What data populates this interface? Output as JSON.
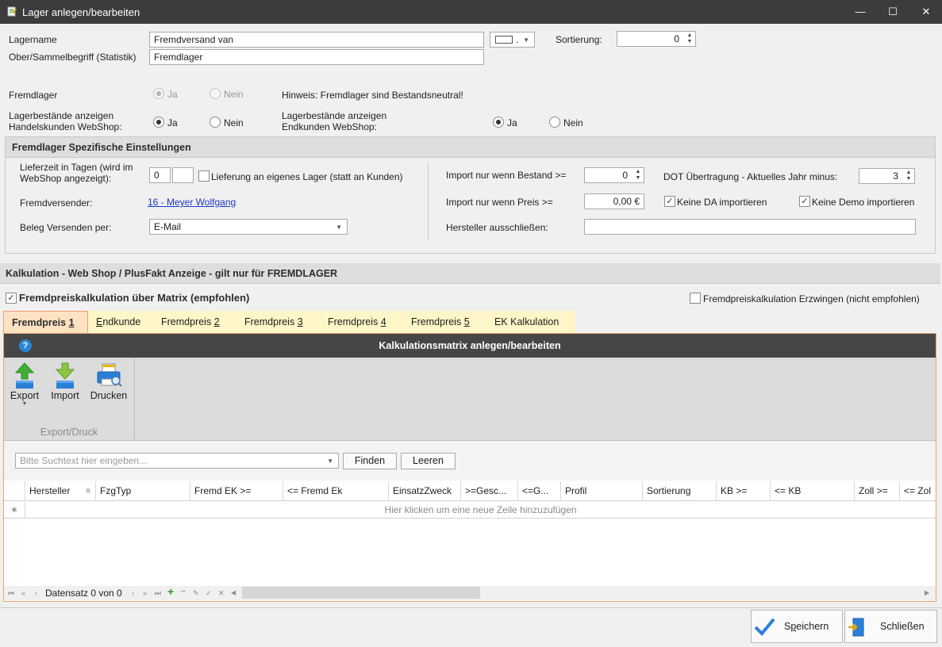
{
  "window": {
    "title": "Lager anlegen/bearbeiten",
    "minimize": "—",
    "maximize": "☐",
    "close": "✕"
  },
  "form": {
    "lagername_label": "Lagername",
    "lagername_value": "Fremdversand van",
    "sammelbegriff_label": "Ober/Sammelbegriff (Statistik)",
    "sammelbegriff_value": "Fremdlager",
    "color_dots": ".",
    "sortierung_label": "Sortierung:",
    "sortierung_value": "0",
    "fremdlager_label": "Fremdlager",
    "ja": "Ja",
    "nein": "Nein",
    "hinweis": "Hinweis: Fremdlager sind Bestandsneutral!",
    "handel_label_1": "Lagerbestände anzeigen",
    "handel_label_2": "Handelskunden WebShop:",
    "endkunden_label_1": "Lagerbestände anzeigen",
    "endkunden_label_2": "Endkunden WebShop:"
  },
  "spezifisch": {
    "header": "Fremdlager Spezifische Einstellungen",
    "lieferzeit_label_1": "Lieferzeit in Tagen (wird im",
    "lieferzeit_label_2": "WebShop angezeigt):",
    "lieferzeit_value1": "0",
    "lieferzeit_value2": "",
    "eigenes_lager_label": "Lieferung an eigenes Lager (statt an Kunden)",
    "fremdversender_label": "Fremdversender:",
    "fremdversender_value": "16 - Meyer Wolfgang",
    "beleg_label": "Beleg Versenden per:",
    "beleg_value": "E-Mail",
    "import_bestand_label": "Import nur wenn Bestand >=",
    "import_bestand_value": "0",
    "dot_label": "DOT Übertragung - Aktuelles Jahr minus:",
    "dot_value": "3",
    "import_preis_label": "Import nur wenn Preis >=",
    "import_preis_value": "0,00 €",
    "keine_da_label": "Keine DA importieren",
    "keine_demo_label": "Keine Demo importieren",
    "hersteller_label": "Hersteller ausschließen:",
    "hersteller_value": ""
  },
  "kalkulation": {
    "header": "Kalkulation - Web Shop / PlusFakt Anzeige - gilt nur für FREMDLAGER",
    "matrix_label": "Fremdpreiskalkulation über Matrix (empfohlen)",
    "erzwingen_label": "Fremdpreiskalkulation Erzwingen (nicht empfohlen)",
    "tabs": [
      {
        "pre": "Fremdpreis ",
        "key": "1",
        "post": ""
      },
      {
        "pre": "",
        "key": "E",
        "post": "ndkunde"
      },
      {
        "pre": "Fremdpreis ",
        "key": "2",
        "post": ""
      },
      {
        "pre": "Fremdpreis ",
        "key": "3",
        "post": ""
      },
      {
        "pre": "Fremdpreis ",
        "key": "4",
        "post": ""
      },
      {
        "pre": "Fremdpreis ",
        "key": "5",
        "post": ""
      },
      {
        "pre": "EK Kalkulation",
        "key": "",
        "post": ""
      }
    ],
    "panel_title": "Kalkulationsmatrix anlegen/bearbeiten",
    "help": "?",
    "export": "Export",
    "import": "Import",
    "drucken": "Drucken",
    "group_label": "Export/Druck",
    "search_placeholder": "Bitte Suchtext hier eingeben...",
    "finden": "Finden",
    "leeren": "Leeren",
    "columns": [
      "Hersteller",
      "FzgTyp",
      "Fremd EK >=",
      "<= Fremd Ek",
      "EinsatzZweck",
      ">=Gesc...",
      "<=G...",
      "Profil",
      "Sortierung",
      "KB >=",
      "<= KB",
      "Zoll >=",
      "<= Zol"
    ],
    "new_row": "Hier klicken um eine neue Zeile hinzuzufügen",
    "new_row_marker": "✱",
    "datensatz": "Datensatz 0 von 0"
  },
  "buttons": {
    "speichern_key": "p",
    "speichern_pre": "S",
    "speichern_post": "eichern",
    "schliessen": "Schließen"
  },
  "colors": {
    "titlebar": "#3c3c3c",
    "panel_header": "#464646",
    "tab_active": "#ffe2c2",
    "tab": "#fff6c7",
    "accent_orange": "#e9a070",
    "link": "#1a38c6"
  }
}
